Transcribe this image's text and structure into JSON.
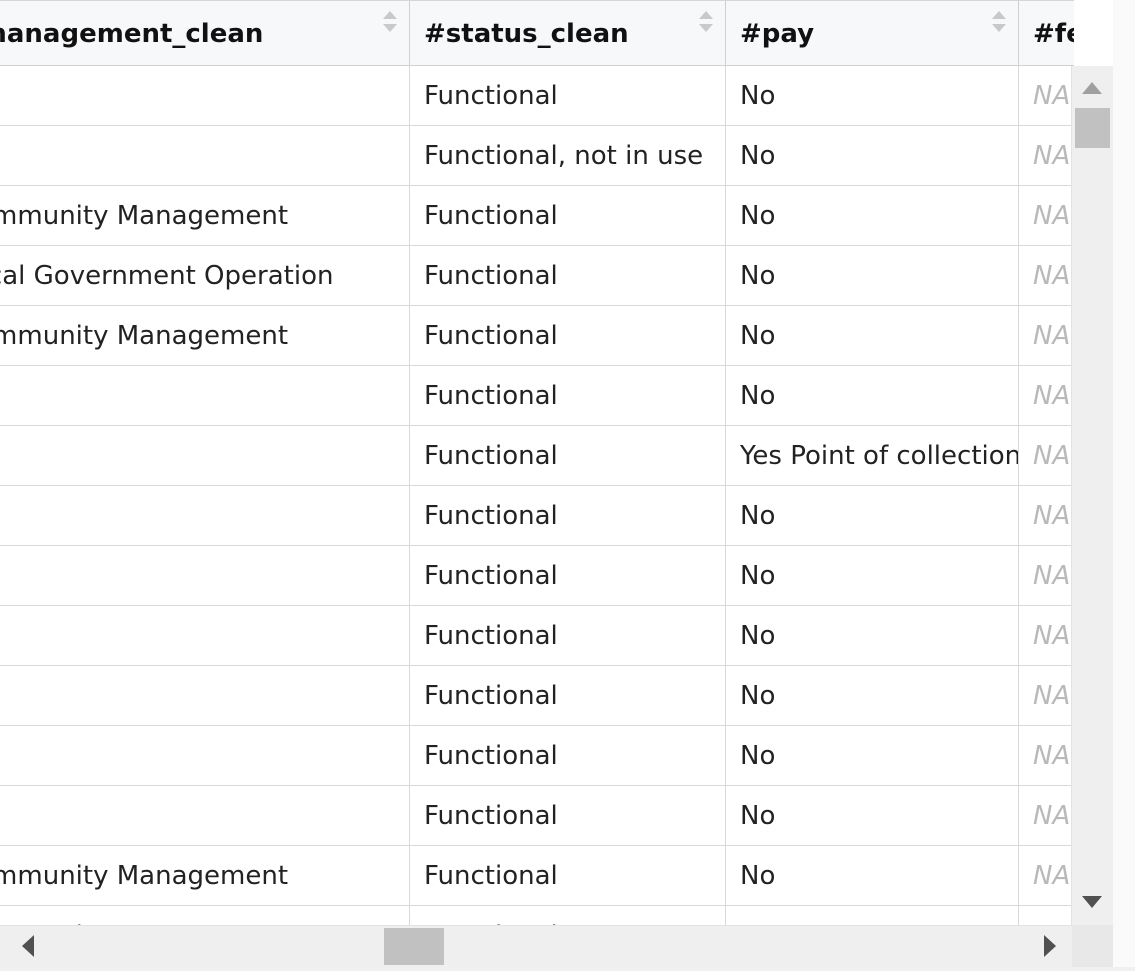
{
  "columns": [
    {
      "label": "#management_clean"
    },
    {
      "label": "#status_clean"
    },
    {
      "label": "#pay"
    },
    {
      "label": "#fecal_"
    }
  ],
  "rows": [
    [
      "",
      "Functional",
      "No",
      "NA"
    ],
    [
      "",
      "Functional, not in use",
      "No",
      "NA"
    ],
    [
      "Community Management",
      "Functional",
      "No",
      "NA"
    ],
    [
      "Local Government Operation",
      "Functional",
      "No",
      "NA"
    ],
    [
      "Community Management",
      "Functional",
      "No",
      "NA"
    ],
    [
      "",
      "Functional",
      "No",
      "NA"
    ],
    [
      "",
      "Functional",
      "Yes Point of collection",
      "NA"
    ],
    [
      "",
      "Functional",
      "No",
      "NA"
    ],
    [
      "",
      "Functional",
      "No",
      "NA"
    ],
    [
      "",
      "Functional",
      "No",
      "NA"
    ],
    [
      "",
      "Functional",
      "No",
      "NA"
    ],
    [
      "",
      "Functional",
      "No",
      "NA"
    ],
    [
      "",
      "Functional",
      "No",
      "NA"
    ],
    [
      "Community Management",
      "Functional",
      "No",
      "NA"
    ],
    [
      "Community Management",
      "Functional",
      "No",
      "NA"
    ]
  ],
  "scroll": {
    "horizontal_position_fraction": 0.4,
    "vertical_position_fraction": 0.02
  },
  "icons": {
    "sort": "sort-arrows-icon",
    "up": "scroll-up-arrow-icon",
    "down": "scroll-down-arrow-icon",
    "left": "scroll-left-arrow-icon",
    "right": "scroll-right-arrow-icon"
  },
  "colors": {
    "header_bg": "#f7f8f9",
    "grid_line": "#d8d8d8",
    "na_text": "#b9b9b9",
    "scrollbar_track": "#efefef",
    "scrollbar_thumb": "#c1c1c1"
  }
}
